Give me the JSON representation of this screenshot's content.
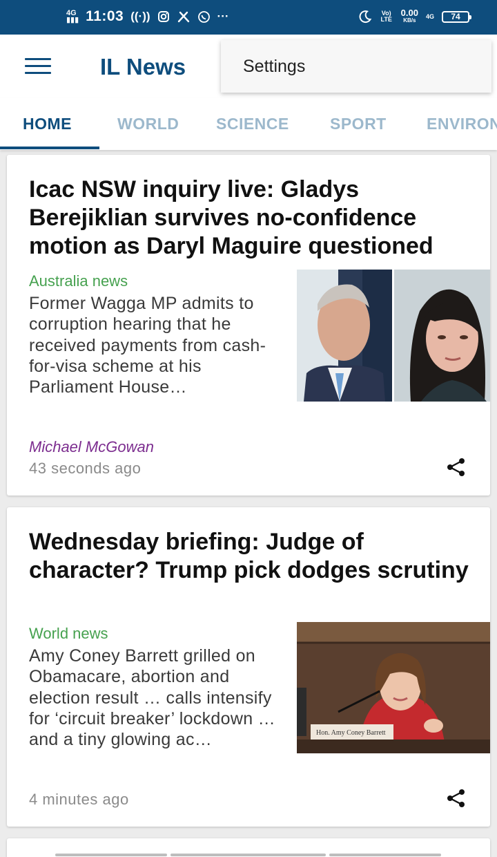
{
  "status_bar": {
    "network": "4G",
    "time": "11:03",
    "more": "···",
    "volte": "Vo) LTE",
    "speed_value": "0.00",
    "speed_unit": "KB/s",
    "network2": "4G",
    "battery": "74"
  },
  "app_bar": {
    "title": "IL News",
    "menu_item": "Settings"
  },
  "tabs": [
    {
      "label": "HOME",
      "active": true
    },
    {
      "label": "WORLD",
      "active": false
    },
    {
      "label": "SCIENCE",
      "active": false
    },
    {
      "label": "SPORT",
      "active": false
    },
    {
      "label": "ENVIRONMENT",
      "active": false
    }
  ],
  "articles": [
    {
      "headline": "Icac NSW inquiry live: Gladys Berejiklian survives no-confidence motion as Daryl Maguire questioned",
      "section": "Australia news",
      "summary": "Former Wagga MP admits to corruption hearing that he received payments from cash-for-visa scheme at his Parliament House…",
      "author": "Michael McGowan",
      "time": "43 seconds ago"
    },
    {
      "headline": "Wednesday briefing: Judge of character? Trump pick dodges scrutiny",
      "section": "World news",
      "summary": "Amy Coney Barrett grilled on Obamacare, abortion and election result … calls intensify for ‘circuit breaker’ lockdown … and a tiny glowing ac…",
      "nameplate": "Hon. Amy Coney Barrett",
      "time": "4 minutes ago"
    }
  ],
  "colors": {
    "primary": "#0e4d7d",
    "tab_inactive": "#9cb8cc",
    "section_green": "#46a14f",
    "author_purple": "#7c2d8f"
  },
  "icons": [
    "menu-icon",
    "share-icon",
    "moon-icon",
    "instagram-icon",
    "tools-icon",
    "whatsapp-icon"
  ]
}
